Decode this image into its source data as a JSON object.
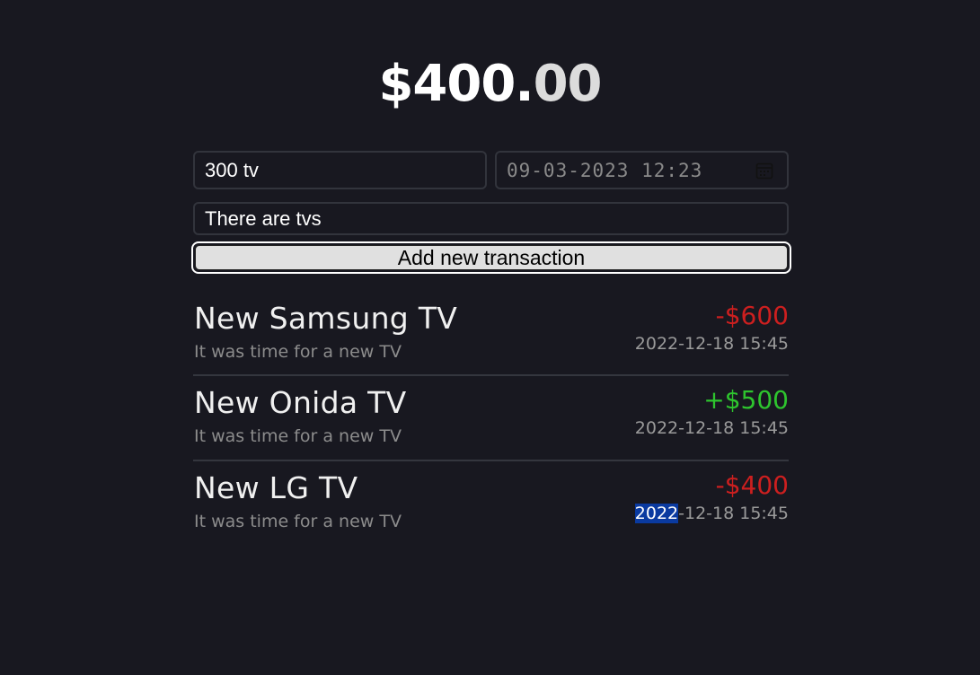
{
  "balance": {
    "dollars": "$400.",
    "cents": "00"
  },
  "form": {
    "name_value": "300 tv",
    "date_value": "09-03-2023 12:23",
    "description_value": "There are tvs",
    "submit_label": "Add new transaction"
  },
  "transactions": [
    {
      "title": "New Samsung TV",
      "description": "It was time for a new TV",
      "amount": "-$600",
      "date": "2022-12-18 15:45"
    },
    {
      "title": "New Onida TV",
      "description": "It was time for a new TV",
      "amount": "+$500",
      "date": "2022-12-18 15:45"
    },
    {
      "title": "New LG TV",
      "description": "It was time for a new TV",
      "amount": "-$400",
      "date_selected_part": "2022",
      "date_rest": "-12-18 15:45"
    }
  ],
  "colors": {
    "background": "#181820",
    "negative": "#cc1f1f",
    "positive": "#2ec42e",
    "selection": "#0a3aa0"
  },
  "icons": {
    "date_picker": "calendar-icon"
  }
}
